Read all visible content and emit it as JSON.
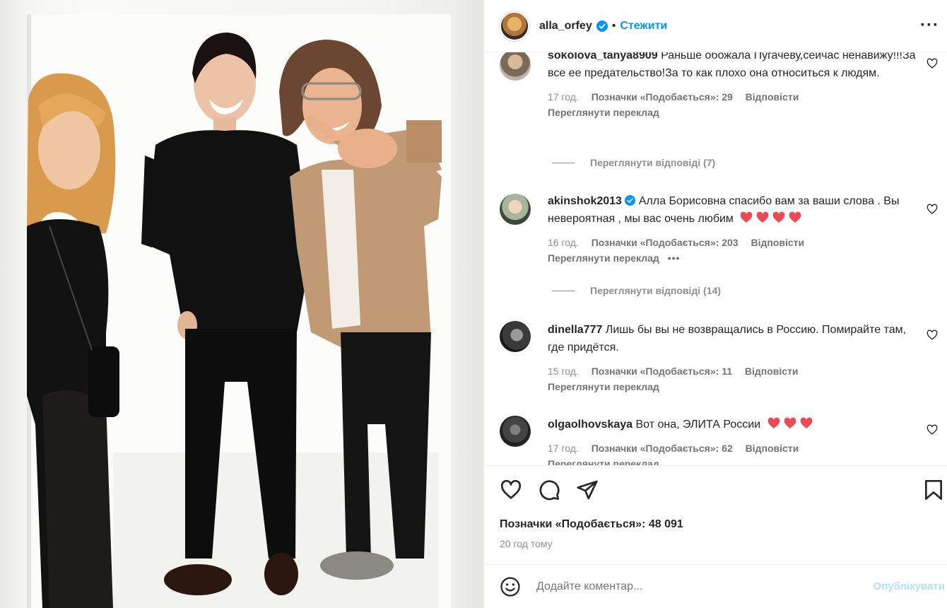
{
  "header": {
    "username": "alla_orfey",
    "separator": "•",
    "follow_label": "Стежити",
    "more_icon": "more-horizontal-icon"
  },
  "comments": [
    {
      "username": "sokolova_tanya8909",
      "text": "Раньше обожала Пугачеву,сейчас ненавижу!!!За все ее предательство!За то как плохо она относиться к людям.",
      "time": "17 год.",
      "likes": "Позначки «Подобається»: 29",
      "reply": "Відповісти",
      "translate": "Переглянути переклад",
      "view_replies": "Переглянути відповіді (7)"
    },
    {
      "username": "akinshok2013",
      "verified": true,
      "text": "Алла Борисовна спасибо вам за ваши слова . Вы невероятная , мы вас очень любим",
      "hearts": 4,
      "time": "16 год.",
      "likes": "Позначки «Подобається»: 203",
      "reply": "Відповісти",
      "translate": "Переглянути переклад",
      "more": "•••",
      "view_replies": "Переглянути відповіді (14)"
    },
    {
      "username": "dinella777",
      "text": "Лишь бы вы не возвращались в Россию. Помирайте там, где придётся.",
      "time": "15 год.",
      "likes": "Позначки «Подобається»: 11",
      "reply": "Відповісти",
      "translate": "Переглянути переклад"
    },
    {
      "username": "olgaolhovskaya",
      "text": "Вот она, ЭЛИТА России",
      "hearts": 3,
      "time": "17 год.",
      "likes": "Позначки «Подобається»: 62",
      "reply": "Відповісти",
      "translate": "Переглянути переклад"
    }
  ],
  "actions": {
    "like_icon": "heart-icon",
    "comment_icon": "comment-icon",
    "share_icon": "send-icon",
    "save_icon": "bookmark-icon",
    "likes_count": "Позначки «Подобається»: 48 091",
    "time_ago": "20 год тому"
  },
  "add_comment": {
    "emoji_icon": "smile-icon",
    "placeholder": "Додайте коментар...",
    "post_label": "Опублікувати"
  },
  "colors": {
    "link_blue": "#0095f6",
    "heart_red": "#ed4956",
    "muted_text": "#8e8e8e",
    "post_disabled": "#b2dffc"
  }
}
